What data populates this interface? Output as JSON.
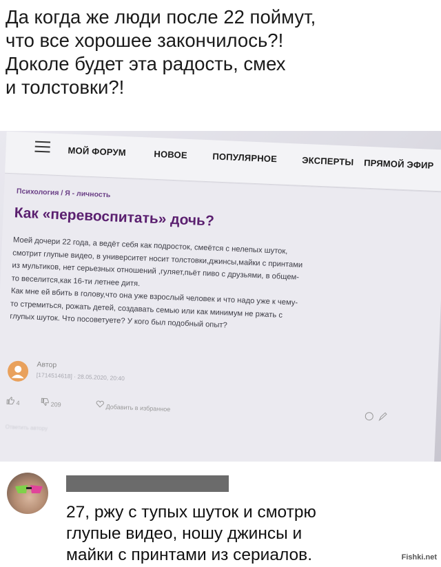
{
  "caption": {
    "lines": [
      "Да когда же люди после 22 поймут,",
      "что все хорошее закончилось?!",
      "Доколе будет эта радость, смех",
      "и толстовки?!"
    ]
  },
  "forum": {
    "nav": {
      "items": [
        "МОЙ ФОРУМ",
        "НОВОЕ",
        "ПОПУЛЯРНОЕ",
        "ЭКСПЕРТЫ",
        "ПРЯМОЙ ЭФИР"
      ]
    },
    "breadcrumb": "Психология / Я - личность",
    "post": {
      "title": "Как «перевоспитать» дочь?",
      "body_lines": [
        "Моей дочери 22 года, а ведёт себя как подросток, смеётся с нелепых шуток,",
        "смотрит глупые видео, в университет носит толстовки,джинсы,майки с принтами",
        "из мультиков, нет серьезных отношений ,гуляет,пьёт пиво с друзьями, в общем-",
        "то веселится,как 16-ти летнее дитя.",
        "Как мне ей вбить в голову,что она уже взрослый человек и что надо уже к чему-",
        "то стремиться, рожать детей, создавать семью или как минимум не ржать с",
        "глупых шуток. Что посоветуете? У кого был подобный опыт?"
      ],
      "author": {
        "label": "Автор",
        "meta": "[1714514618] · 28.05.2020, 20:40"
      },
      "actions": {
        "likes": "4",
        "dislikes": "209",
        "favorite": "Добавить в избранное"
      },
      "footer": "Ответить автору"
    }
  },
  "comment": {
    "lines": [
      "27, ржу с тупых шуток и смотрю",
      "глупые видео, ношу джинсы и",
      "майки с принтами из сериалов."
    ]
  },
  "watermark": "Fishki.net",
  "colors": {
    "title": "#5a1f6f",
    "breadcrumb": "#6a3f86",
    "redaction": "#6b6b6b",
    "avatar_author": "#e9a15c"
  }
}
